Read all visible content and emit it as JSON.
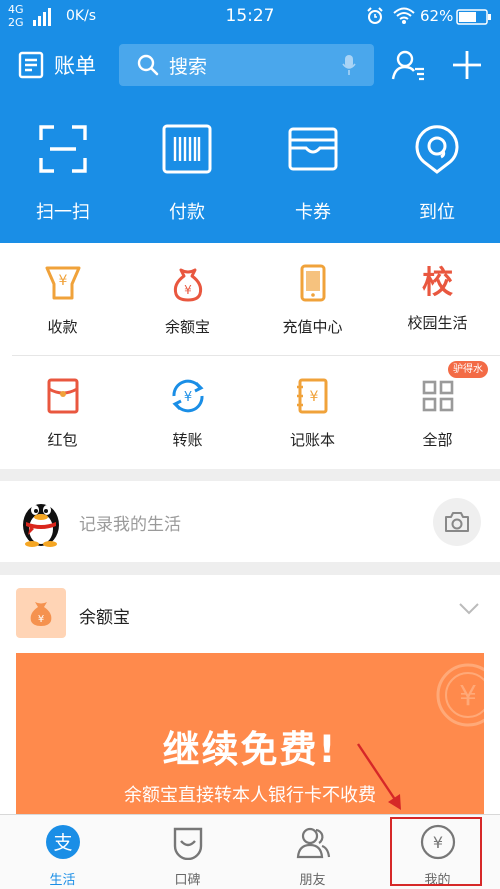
{
  "status_bar": {
    "network_top": "4G",
    "network_bottom": "2G",
    "speed": "0K/s",
    "time": "15:27",
    "battery": "62%",
    "icons": [
      "signal-icon",
      "alarm-icon",
      "wifi-icon",
      "battery-icon"
    ]
  },
  "header": {
    "bill_label": "账单",
    "search_placeholder": "搜索",
    "icons": [
      "bill-icon",
      "search-icon",
      "mic-icon",
      "contacts-icon",
      "plus-icon"
    ]
  },
  "quick_actions": [
    {
      "label": "扫一扫",
      "icon": "scan-icon"
    },
    {
      "label": "付款",
      "icon": "barcode-icon"
    },
    {
      "label": "卡券",
      "icon": "card-icon"
    },
    {
      "label": "到位",
      "icon": "location-icon"
    }
  ],
  "services": [
    {
      "label": "收款",
      "icon": "receive-money-icon"
    },
    {
      "label": "余额宝",
      "icon": "moneybag-icon"
    },
    {
      "label": "充值中心",
      "icon": "phone-recharge-icon"
    },
    {
      "label": "校园生活",
      "icon": "campus-icon",
      "glyph": "校"
    },
    {
      "label": "红包",
      "icon": "red-envelope-icon"
    },
    {
      "label": "转账",
      "icon": "transfer-icon"
    },
    {
      "label": "记账本",
      "icon": "ledger-icon"
    },
    {
      "label": "全部",
      "icon": "grid-all-icon"
    }
  ],
  "badge": "驴得水",
  "record": {
    "placeholder": "记录我的生活",
    "icons": [
      "qq-penguin-avatar",
      "camera-icon"
    ]
  },
  "yuebao_card": {
    "title": "余额宝",
    "banner_headline": "继续免费!",
    "banner_subtitle": "余额宝直接转本人银行卡不收费"
  },
  "tabs": [
    {
      "label": "生活",
      "icon": "alipay-icon",
      "active": true
    },
    {
      "label": "口碑",
      "icon": "koubei-icon",
      "active": false
    },
    {
      "label": "朋友",
      "icon": "friends-icon",
      "active": false
    },
    {
      "label": "我的",
      "icon": "my-wallet-icon",
      "active": false
    }
  ],
  "colors": {
    "brand_blue": "#1a8ee6",
    "banner_orange": "#ff8a4c",
    "service_orange": "#f0a23a",
    "service_red": "#e9573f",
    "highlight_red": "#d62828"
  }
}
